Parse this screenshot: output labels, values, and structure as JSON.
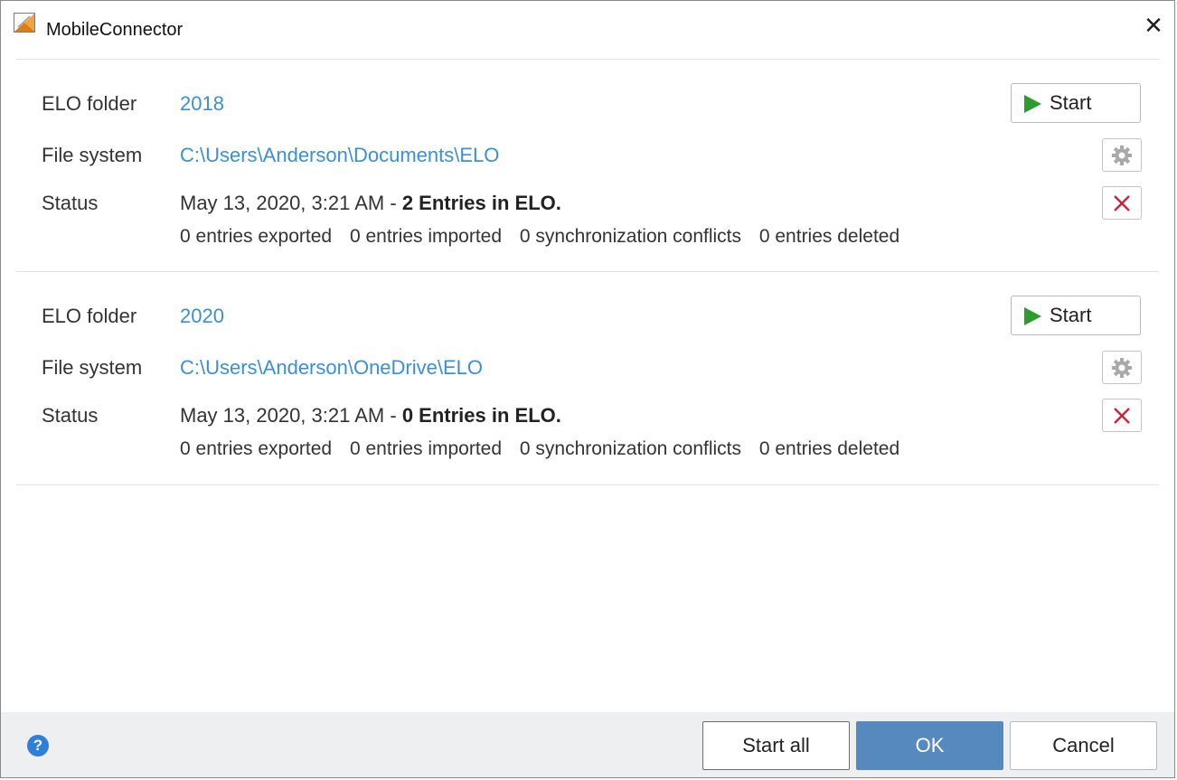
{
  "window": {
    "title": "MobileConnector"
  },
  "labels": {
    "folder": "ELO folder",
    "filesystem": "File system",
    "status": "Status"
  },
  "entries": [
    {
      "folder": "2018",
      "path": "C:\\Users\\Anderson\\Documents\\ELO",
      "status_time": "May 13, 2020, 3:21 AM - ",
      "status_result": "2 Entries in ELO.",
      "counts": [
        "0 entries exported",
        "0 entries imported",
        "0 synchronization conflicts",
        "0 entries deleted"
      ],
      "start_label": "Start"
    },
    {
      "folder": "2020",
      "path": "C:\\Users\\Anderson\\OneDrive\\ELO",
      "status_time": "May 13, 2020, 3:21 AM - ",
      "status_result": "0 Entries in ELO.",
      "counts": [
        "0 entries exported",
        "0 entries imported",
        "0 synchronization conflicts",
        "0 entries deleted"
      ],
      "start_label": "Start"
    }
  ],
  "footer": {
    "help": "?",
    "start_all": "Start all",
    "ok": "OK",
    "cancel": "Cancel"
  },
  "icons": {
    "play": "play-icon",
    "settings": "gear-icon",
    "remove": "delete-x-icon",
    "help": "help-icon",
    "close": "close-icon"
  },
  "colors": {
    "link": "#3b8fd6",
    "play": "#2e9b2e",
    "remove": "#c8243c",
    "ok": "#5689bd",
    "footer": "#eeeff0"
  }
}
